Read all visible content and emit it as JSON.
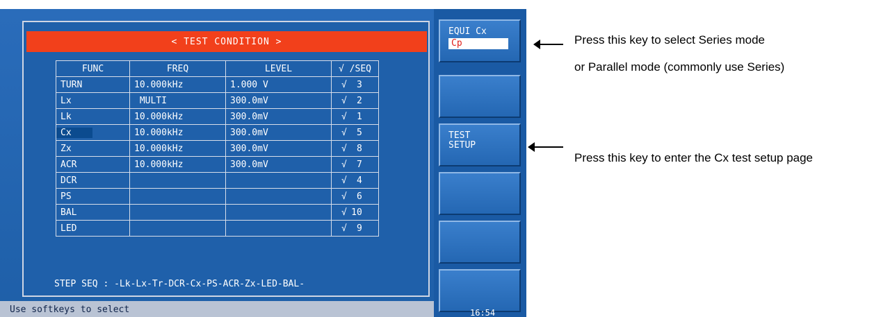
{
  "title": "< TEST CONDITION >",
  "table": {
    "headers": [
      "FUNC",
      "FREQ",
      "LEVEL",
      "√ /SEQ"
    ],
    "rows": [
      {
        "func": "TURN",
        "freq": "10.000kHz",
        "level": "1.000 V",
        "check": "√",
        "seq": "3"
      },
      {
        "func": "Lx",
        "freq": " MULTI",
        "level": "300.0mV",
        "check": "√",
        "seq": "2"
      },
      {
        "func": "Lk",
        "freq": "10.000kHz",
        "level": "300.0mV",
        "check": "√",
        "seq": "1"
      },
      {
        "func": "Cx",
        "freq": "10.000kHz",
        "level": "300.0mV",
        "check": "√",
        "seq": "5"
      },
      {
        "func": "Zx",
        "freq": "10.000kHz",
        "level": "300.0mV",
        "check": "√",
        "seq": "8"
      },
      {
        "func": "ACR",
        "freq": "10.000kHz",
        "level": "300.0mV",
        "check": "√",
        "seq": "7"
      },
      {
        "func": "DCR",
        "freq": "",
        "level": "",
        "check": "√",
        "seq": "4"
      },
      {
        "func": "PS",
        "freq": "",
        "level": "",
        "check": "√",
        "seq": "6"
      },
      {
        "func": "BAL",
        "freq": "",
        "level": "",
        "check": "√",
        "seq": "10"
      },
      {
        "func": "LED",
        "freq": "",
        "level": "",
        "check": "√",
        "seq": "9"
      }
    ],
    "selected_func": "Cx"
  },
  "step_seq": "STEP SEQ : -Lk-Lx-Tr-DCR-Cx-PS-ACR-Zx-LED-BAL-",
  "status": "Use softkeys to select",
  "softkeys": {
    "equi_label": "EQUI Cx",
    "equi_value": "Cp",
    "test_setup_line1": "TEST",
    "test_setup_line2": "SETUP"
  },
  "clock": "16:54",
  "annotations": {
    "equi_line1": "Press this key to select Series mode",
    "equi_line2": "or Parallel mode (commonly use Series)",
    "setup": "Press this key to enter the Cx test setup page"
  },
  "colors": {
    "screen_bg": "#1f63b0",
    "title_bar": "#f2401b",
    "status_bar": "#b9c3d4",
    "cp_value": "#e0201b"
  }
}
